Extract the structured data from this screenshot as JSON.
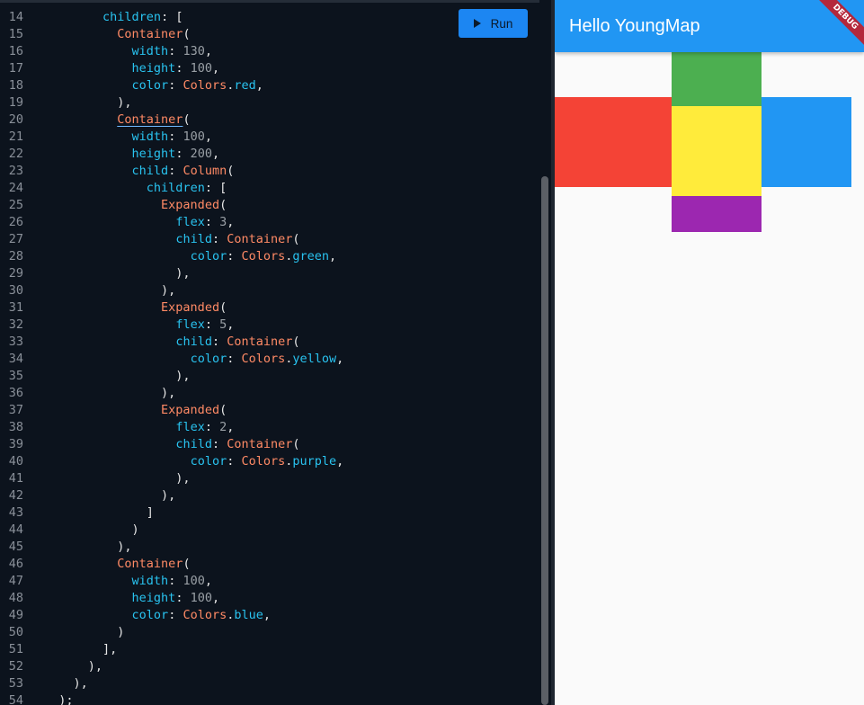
{
  "editor": {
    "run_label": "Run",
    "lines": [
      {
        "num": "14",
        "segs": [
          [
            "p",
            "        "
          ],
          [
            "k",
            "children"
          ],
          [
            "p",
            ": ["
          ]
        ]
      },
      {
        "num": "15",
        "segs": [
          [
            "p",
            "          "
          ],
          [
            "c",
            "Container"
          ],
          [
            "p",
            "("
          ]
        ]
      },
      {
        "num": "16",
        "segs": [
          [
            "p",
            "            "
          ],
          [
            "k",
            "width"
          ],
          [
            "p",
            ": "
          ],
          [
            "n",
            "130"
          ],
          [
            "p",
            ","
          ]
        ]
      },
      {
        "num": "17",
        "segs": [
          [
            "p",
            "            "
          ],
          [
            "k",
            "height"
          ],
          [
            "p",
            ": "
          ],
          [
            "n",
            "100"
          ],
          [
            "p",
            ","
          ]
        ]
      },
      {
        "num": "18",
        "segs": [
          [
            "p",
            "            "
          ],
          [
            "k",
            "color"
          ],
          [
            "p",
            ": "
          ],
          [
            "c",
            "Colors"
          ],
          [
            "p",
            "."
          ],
          [
            "k",
            "red"
          ],
          [
            "p",
            ","
          ]
        ]
      },
      {
        "num": "19",
        "segs": [
          [
            "p",
            "          ),"
          ]
        ]
      },
      {
        "num": "20",
        "segs": [
          [
            "p",
            "          "
          ],
          [
            "cu",
            "Container"
          ],
          [
            "p",
            "("
          ]
        ]
      },
      {
        "num": "21",
        "segs": [
          [
            "p",
            "            "
          ],
          [
            "k",
            "width"
          ],
          [
            "p",
            ": "
          ],
          [
            "n",
            "100"
          ],
          [
            "p",
            ","
          ]
        ]
      },
      {
        "num": "22",
        "segs": [
          [
            "p",
            "            "
          ],
          [
            "k",
            "height"
          ],
          [
            "p",
            ": "
          ],
          [
            "n",
            "200"
          ],
          [
            "p",
            ","
          ]
        ]
      },
      {
        "num": "23",
        "segs": [
          [
            "p",
            "            "
          ],
          [
            "k",
            "child"
          ],
          [
            "p",
            ": "
          ],
          [
            "c",
            "Column"
          ],
          [
            "p",
            "("
          ]
        ]
      },
      {
        "num": "24",
        "segs": [
          [
            "p",
            "              "
          ],
          [
            "k",
            "children"
          ],
          [
            "p",
            ": ["
          ]
        ]
      },
      {
        "num": "25",
        "segs": [
          [
            "p",
            "                "
          ],
          [
            "c",
            "Expanded"
          ],
          [
            "p",
            "("
          ]
        ]
      },
      {
        "num": "26",
        "segs": [
          [
            "p",
            "                  "
          ],
          [
            "k",
            "flex"
          ],
          [
            "p",
            ": "
          ],
          [
            "n",
            "3"
          ],
          [
            "p",
            ","
          ]
        ]
      },
      {
        "num": "27",
        "segs": [
          [
            "p",
            "                  "
          ],
          [
            "k",
            "child"
          ],
          [
            "p",
            ": "
          ],
          [
            "c",
            "Container"
          ],
          [
            "p",
            "("
          ]
        ]
      },
      {
        "num": "28",
        "segs": [
          [
            "p",
            "                    "
          ],
          [
            "k",
            "color"
          ],
          [
            "p",
            ": "
          ],
          [
            "c",
            "Colors"
          ],
          [
            "p",
            "."
          ],
          [
            "k",
            "green"
          ],
          [
            "p",
            ","
          ]
        ]
      },
      {
        "num": "29",
        "segs": [
          [
            "p",
            "                  ),"
          ]
        ]
      },
      {
        "num": "30",
        "segs": [
          [
            "p",
            "                ),"
          ]
        ]
      },
      {
        "num": "31",
        "segs": [
          [
            "p",
            "                "
          ],
          [
            "c",
            "Expanded"
          ],
          [
            "p",
            "("
          ]
        ]
      },
      {
        "num": "32",
        "segs": [
          [
            "p",
            "                  "
          ],
          [
            "k",
            "flex"
          ],
          [
            "p",
            ": "
          ],
          [
            "n",
            "5"
          ],
          [
            "p",
            ","
          ]
        ]
      },
      {
        "num": "33",
        "segs": [
          [
            "p",
            "                  "
          ],
          [
            "k",
            "child"
          ],
          [
            "p",
            ": "
          ],
          [
            "c",
            "Container"
          ],
          [
            "p",
            "("
          ]
        ]
      },
      {
        "num": "34",
        "segs": [
          [
            "p",
            "                    "
          ],
          [
            "k",
            "color"
          ],
          [
            "p",
            ": "
          ],
          [
            "c",
            "Colors"
          ],
          [
            "p",
            "."
          ],
          [
            "k",
            "yellow"
          ],
          [
            "p",
            ","
          ]
        ]
      },
      {
        "num": "35",
        "segs": [
          [
            "p",
            "                  ),"
          ]
        ]
      },
      {
        "num": "36",
        "segs": [
          [
            "p",
            "                ),"
          ]
        ]
      },
      {
        "num": "37",
        "segs": [
          [
            "p",
            "                "
          ],
          [
            "c",
            "Expanded"
          ],
          [
            "p",
            "("
          ]
        ]
      },
      {
        "num": "38",
        "segs": [
          [
            "p",
            "                  "
          ],
          [
            "k",
            "flex"
          ],
          [
            "p",
            ": "
          ],
          [
            "n",
            "2"
          ],
          [
            "p",
            ","
          ]
        ]
      },
      {
        "num": "39",
        "segs": [
          [
            "p",
            "                  "
          ],
          [
            "k",
            "child"
          ],
          [
            "p",
            ": "
          ],
          [
            "c",
            "Container"
          ],
          [
            "p",
            "("
          ]
        ]
      },
      {
        "num": "40",
        "segs": [
          [
            "p",
            "                    "
          ],
          [
            "k",
            "color"
          ],
          [
            "p",
            ": "
          ],
          [
            "c",
            "Colors"
          ],
          [
            "p",
            "."
          ],
          [
            "k",
            "purple"
          ],
          [
            "p",
            ","
          ]
        ]
      },
      {
        "num": "41",
        "segs": [
          [
            "p",
            "                  ),"
          ]
        ]
      },
      {
        "num": "42",
        "segs": [
          [
            "p",
            "                ),"
          ]
        ]
      },
      {
        "num": "43",
        "segs": [
          [
            "p",
            "              ]"
          ]
        ]
      },
      {
        "num": "44",
        "segs": [
          [
            "p",
            "            )"
          ]
        ]
      },
      {
        "num": "45",
        "segs": [
          [
            "p",
            "          ),"
          ]
        ]
      },
      {
        "num": "46",
        "segs": [
          [
            "p",
            "          "
          ],
          [
            "c",
            "Container"
          ],
          [
            "p",
            "("
          ]
        ]
      },
      {
        "num": "47",
        "segs": [
          [
            "p",
            "            "
          ],
          [
            "k",
            "width"
          ],
          [
            "p",
            ": "
          ],
          [
            "n",
            "100"
          ],
          [
            "p",
            ","
          ]
        ]
      },
      {
        "num": "48",
        "segs": [
          [
            "p",
            "            "
          ],
          [
            "k",
            "height"
          ],
          [
            "p",
            ": "
          ],
          [
            "n",
            "100"
          ],
          [
            "p",
            ","
          ]
        ]
      },
      {
        "num": "49",
        "segs": [
          [
            "p",
            "            "
          ],
          [
            "k",
            "color"
          ],
          [
            "p",
            ": "
          ],
          [
            "c",
            "Colors"
          ],
          [
            "p",
            "."
          ],
          [
            "k",
            "blue"
          ],
          [
            "p",
            ","
          ]
        ]
      },
      {
        "num": "50",
        "segs": [
          [
            "p",
            "          )"
          ]
        ]
      },
      {
        "num": "51",
        "segs": [
          [
            "p",
            "        ],"
          ]
        ]
      },
      {
        "num": "52",
        "segs": [
          [
            "p",
            "      ),"
          ]
        ]
      },
      {
        "num": "53",
        "segs": [
          [
            "p",
            "    ),"
          ]
        ]
      },
      {
        "num": "54",
        "segs": [
          [
            "p",
            "  );"
          ]
        ]
      }
    ]
  },
  "preview": {
    "app_title": "Hello YoungMap",
    "debug_label": "DEBUG",
    "colors": {
      "app_bar": "#2196f3",
      "red": "#f44336",
      "green": "#4caf50",
      "yellow": "#ffeb3b",
      "purple": "#9c27b0",
      "blue": "#2196f3"
    }
  }
}
